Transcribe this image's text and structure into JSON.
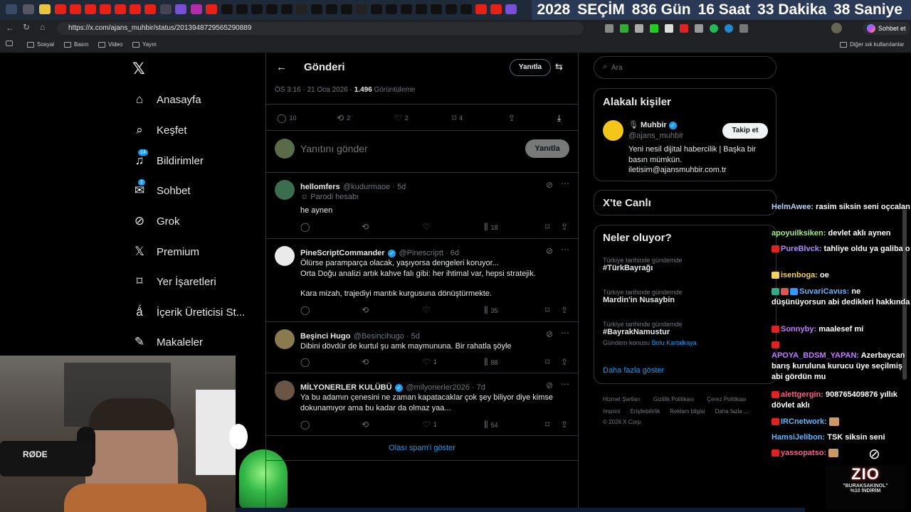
{
  "countdown": {
    "year": "2028",
    "event": "SEÇİM",
    "days": "836 Gün",
    "hours": "16 Saat",
    "minutes": "33 Dakika",
    "seconds": "38 Saniye"
  },
  "browser": {
    "url": "https://x.com/ajans_muhbir/status/2013948729565290889",
    "chat_button": "Sohbet et",
    "bookmarks": [
      "Sosyal",
      "Basın",
      "Video",
      "Yayın"
    ],
    "other_bookmarks": "Diğer sık kullanılanlar"
  },
  "nav": {
    "items": [
      {
        "label": "Anasayfa",
        "icon": "home-icon"
      },
      {
        "label": "Keşfet",
        "icon": "search-icon"
      },
      {
        "label": "Bildirimler",
        "icon": "bell-icon",
        "badge": "14"
      },
      {
        "label": "Sohbet",
        "icon": "mail-icon",
        "badge": "2"
      },
      {
        "label": "Grok",
        "icon": "grok-icon"
      },
      {
        "label": "Premium",
        "icon": "x-logo-icon"
      },
      {
        "label": "Yer İşaretleri",
        "icon": "bookmark-icon"
      },
      {
        "label": "İçerik Üreticisi St...",
        "icon": "creator-icon"
      },
      {
        "label": "Makaleler",
        "icon": "article-icon"
      }
    ]
  },
  "header": {
    "title": "Gönderi",
    "reply_button": "Yanıtla"
  },
  "post_meta": {
    "time": "ÖS 3:16 · 21 Oca 2026 ·",
    "views": "1.496",
    "views_label": "Görüntüleme"
  },
  "post_stats": {
    "replies": "10",
    "reposts": "2",
    "likes": "2",
    "bookmarks": "4"
  },
  "compose": {
    "placeholder": "Yanıtını gönder",
    "button": "Yanıtla"
  },
  "replies": [
    {
      "name": "hellomfers",
      "handle": "@kudurmaoe · 5d",
      "parody": "Parodi hesabı",
      "text": [
        "he aynen"
      ],
      "likes": "",
      "views": "18",
      "verified": false
    },
    {
      "name": "PineScriptCommander",
      "handle": "@Pinescriptt · 6d",
      "text": [
        "Ölürse paramparça olacak, yaşıyorsa dengeleri koruyor...",
        "Orta Doğu analizi artık kahve falı gibi: her ihtimal var, hepsi stratejik.",
        "",
        "Kara mizah, trajediyi mantık kurgusuna dönüştürmekte."
      ],
      "likes": "",
      "views": "35",
      "verified": true
    },
    {
      "name": "Beşinci Hugo",
      "handle": "@Besincihugo · 5d",
      "text": [
        "Dibini dövdür de kurtul şu amk maymununa. Bir rahatla şöyle"
      ],
      "likes": "1",
      "views": "88",
      "verified": false
    },
    {
      "name": "MİLYONERLER KULÜBÜ",
      "handle": "@milyonerler2026 · 7d",
      "text": [
        "Ya bu adamın çenesini ne zaman kapatacaklar çok şey biliyor diye kimse",
        "dokunamıyor ama bu kadar da olmaz yaa..."
      ],
      "likes": "1",
      "views": "54",
      "verified": true
    }
  ],
  "spam_link": "Olası spam'i göster",
  "search": {
    "placeholder": "Ara"
  },
  "related": {
    "title": "Alakalı kişiler",
    "name": "Muhbir",
    "handle": "@ajans_muhbir",
    "follow": "Takip et",
    "bio": [
      "Yeni nesil dijital habercilik | Başka bir",
      "basın mümkün.",
      "iletisim@ajansmuhbir.com.tr"
    ]
  },
  "live": {
    "title": "X'te Canlı"
  },
  "trends": {
    "title": "Neler oluyor?",
    "items": [
      {
        "category": "Türkiye tarihinde gündemde",
        "name": "#TürkBayrağı",
        "extra": ""
      },
      {
        "category": "Türkiye tarihinde gündemde",
        "name": "Mardin'in Nusaybin",
        "extra": ""
      },
      {
        "category": "Türkiye tarihinde gündemde",
        "name": "#BayrakNamustur",
        "extra": "Gündem konusu",
        "extra_link": "Bolu Kartalkaya"
      }
    ],
    "show_more": "Daha fazla göster"
  },
  "footer": {
    "row1": [
      "Hizmet Şartları",
      "Gizlilik Politikası",
      "Çerez Politikası"
    ],
    "row2": [
      "Imprint",
      "Erişilebilirlik",
      "Reklam bilgisi",
      "Daha fazla ..."
    ],
    "copyright": "© 2026 X Corp."
  },
  "chat": [
    {
      "user": "HelmAwee:",
      "msg": "rasim siksin seni oçcalan",
      "color": "#b9d4ff"
    },
    {
      "user": "apoyuilksiken:",
      "msg": "devlet aklı aynen",
      "color": "#9ff07f"
    },
    {
      "user": "PureBlvck:",
      "msg": "tahliye oldu ya galiba o",
      "color": "#b48bff"
    },
    {
      "user": "isenboga:",
      "msg": "oe",
      "color": "#f3d35d"
    },
    {
      "user": "SuvariCavus:",
      "msg": "ne düşünüyorsun abi dedikleri hakkında",
      "color": "#64b5ff"
    },
    {
      "user": "Sonnyby:",
      "msg": "maalesef mi",
      "color": "#c27dff"
    },
    {
      "user": "APOYA_BDSM_YAPAN:",
      "msg": "Azerbaycan barış kuruluna kurucu üye seçilmiş abi gördün mu",
      "color": "#c27dff"
    },
    {
      "user": "alettgergin:",
      "msg": "908765409876 yıllık dövlet aklı",
      "color": "#ff5d8a"
    },
    {
      "user": "IRCnetwork:",
      "msg": "",
      "color": "#64b5ff"
    },
    {
      "user": "HamsiJelibon:",
      "msg": "TSK siksin seni",
      "color": "#64b5ff"
    },
    {
      "user": "yassopatso:",
      "msg": "",
      "color": "#ff5d8a"
    }
  ],
  "stream": {
    "mic_brand": "RØDE",
    "promo_brand": "ZIO",
    "promo_code": "\"BURAKSAKINOL\"",
    "promo_discount": "%10 İNDİRİM"
  }
}
